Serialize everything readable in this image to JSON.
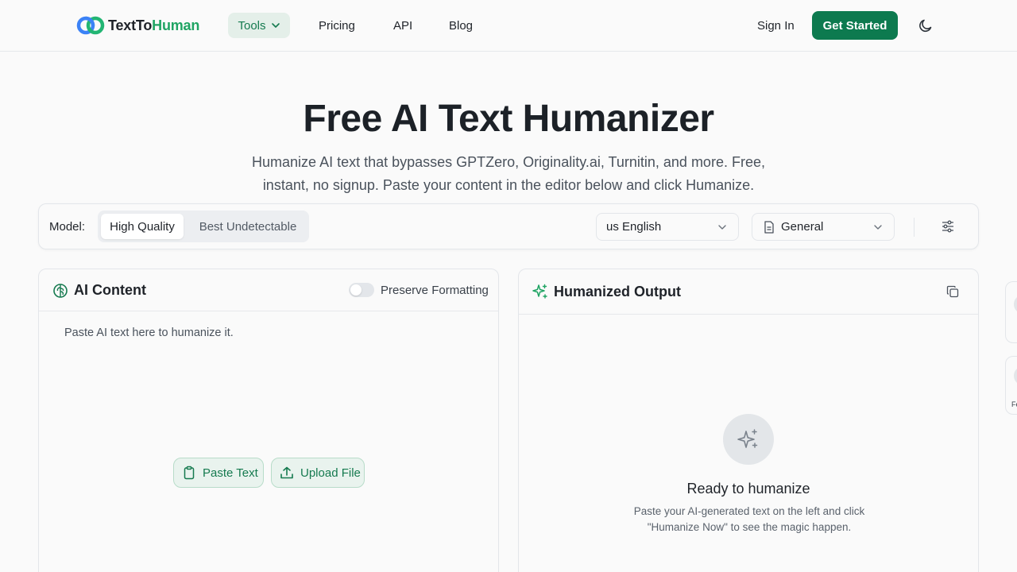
{
  "brand": {
    "logo_part1": "TextTo",
    "logo_part2": "Human"
  },
  "nav": {
    "tools": "Tools",
    "links": [
      "Pricing",
      "API",
      "Blog"
    ],
    "sign_in": "Sign In",
    "get_started": "Get Started"
  },
  "hero": {
    "title": "Free AI Text Humanizer",
    "subtitle": "Humanize AI text that bypasses GPTZero, Originality.ai, Turnitin, and more. Free, instant, no signup. Paste your content in the editor below and click Humanize."
  },
  "toolbar": {
    "model_label": "Model:",
    "models": [
      "High Quality",
      "Best Undetectable"
    ],
    "selected_model": "High Quality",
    "language": "us English",
    "mode": "General"
  },
  "input_panel": {
    "title": "AI Content",
    "preserve_formatting": "Preserve Formatting",
    "preserve_formatting_on": false,
    "placeholder": "Paste AI text here to humanize it.",
    "paste_button": "Paste Text",
    "upload_button": "Upload File"
  },
  "output_panel": {
    "title": "Humanized Output",
    "empty_title": "Ready to humanize",
    "empty_desc": "Paste your AI-generated text on the left and click \"Humanize Now\" to see the magic happen."
  },
  "edge": {
    "partial_text": "Fe"
  },
  "colors": {
    "brand_green": "#0d7a4f",
    "accent_green": "#1fa463",
    "logo_blue": "#3b82f6"
  }
}
